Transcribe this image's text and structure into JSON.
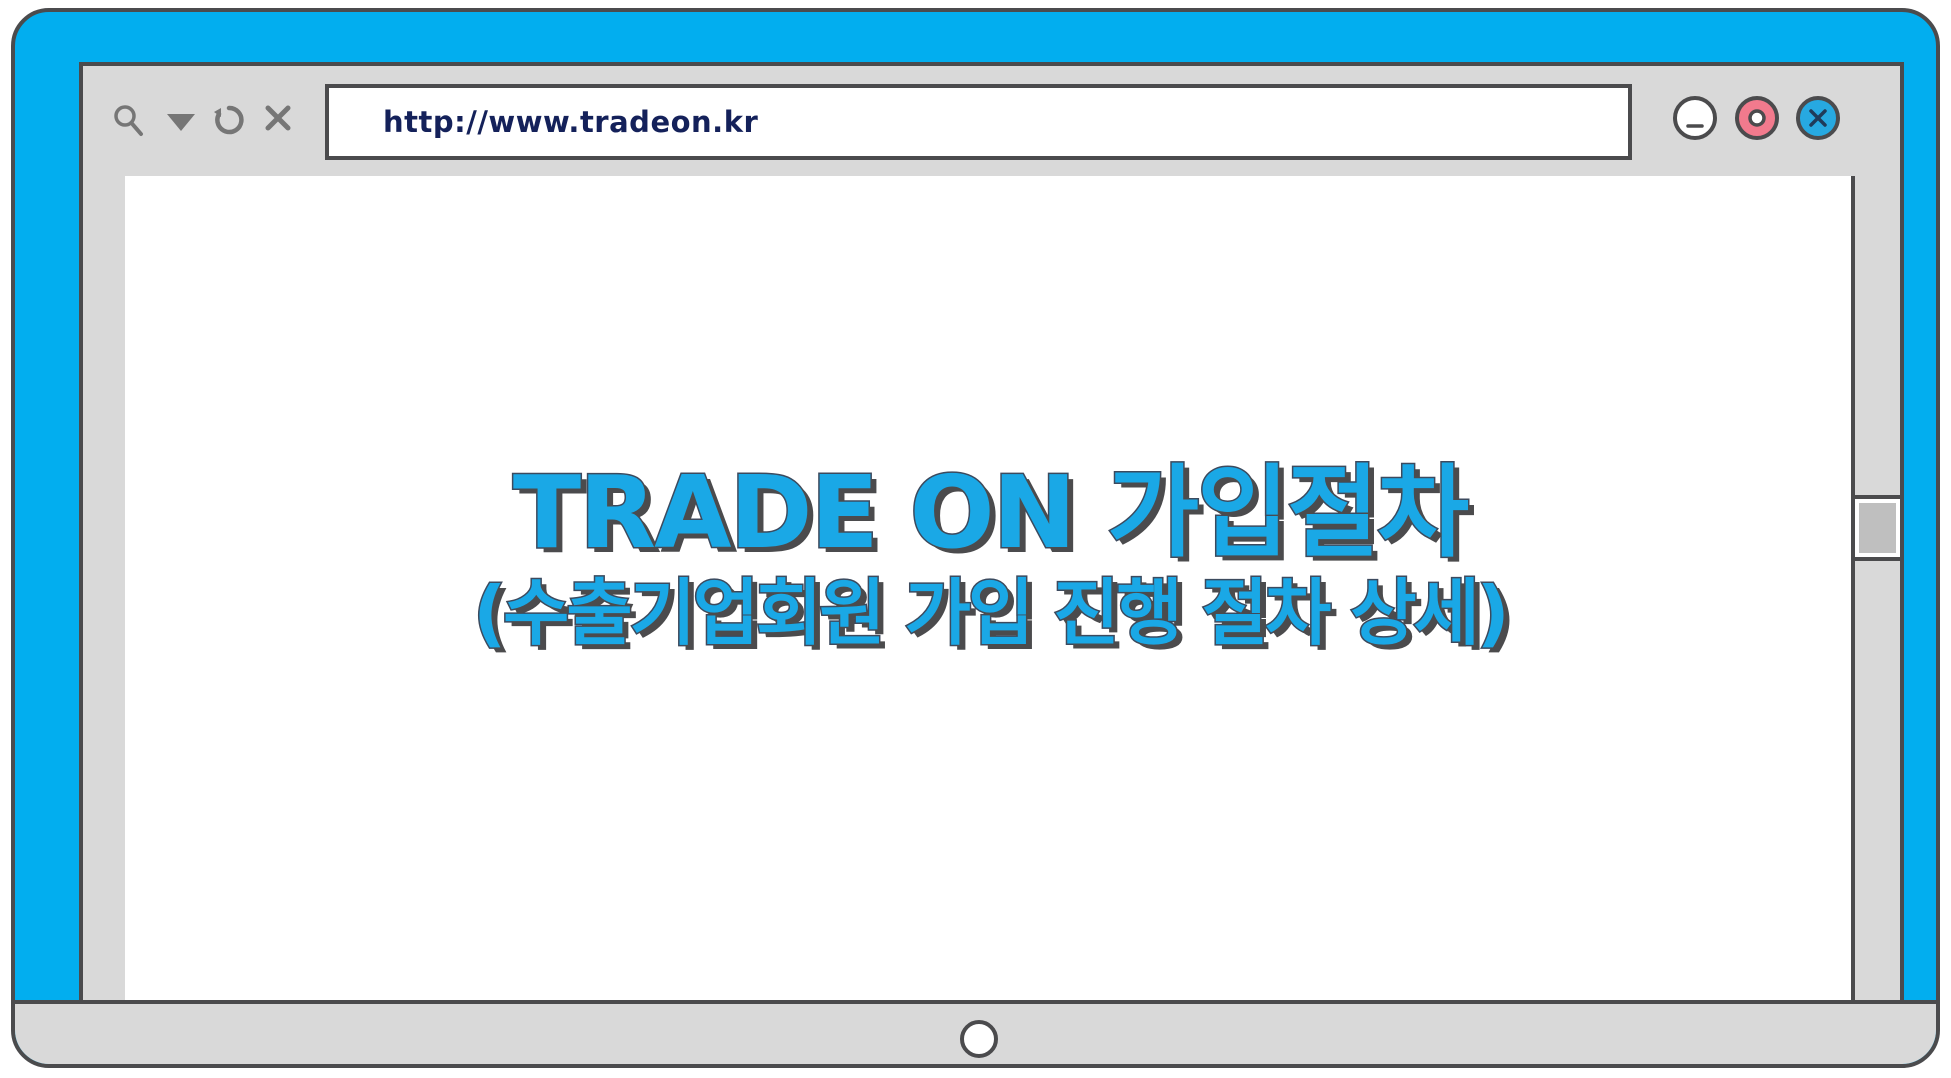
{
  "browser": {
    "url": "http://www.tradeon.kr",
    "nav_icons": [
      "search-icon",
      "dropdown-icon",
      "refresh-icon",
      "stop-icon"
    ],
    "window_buttons": [
      "minimize-icon",
      "maximize-icon",
      "close-icon"
    ]
  },
  "content": {
    "title": "TRADE ON 가입절차",
    "subtitle": "(수출기업회원 가입 진행 절차 상세)"
  },
  "colors": {
    "bezel": "#02aeef",
    "frame": "#d9d9d9",
    "outline": "#4b4b4d",
    "title_fill": "#1aa8e6",
    "url_text": "#14215a",
    "maximize_button": "#f27a8d",
    "close_button": "#27a9e1"
  }
}
